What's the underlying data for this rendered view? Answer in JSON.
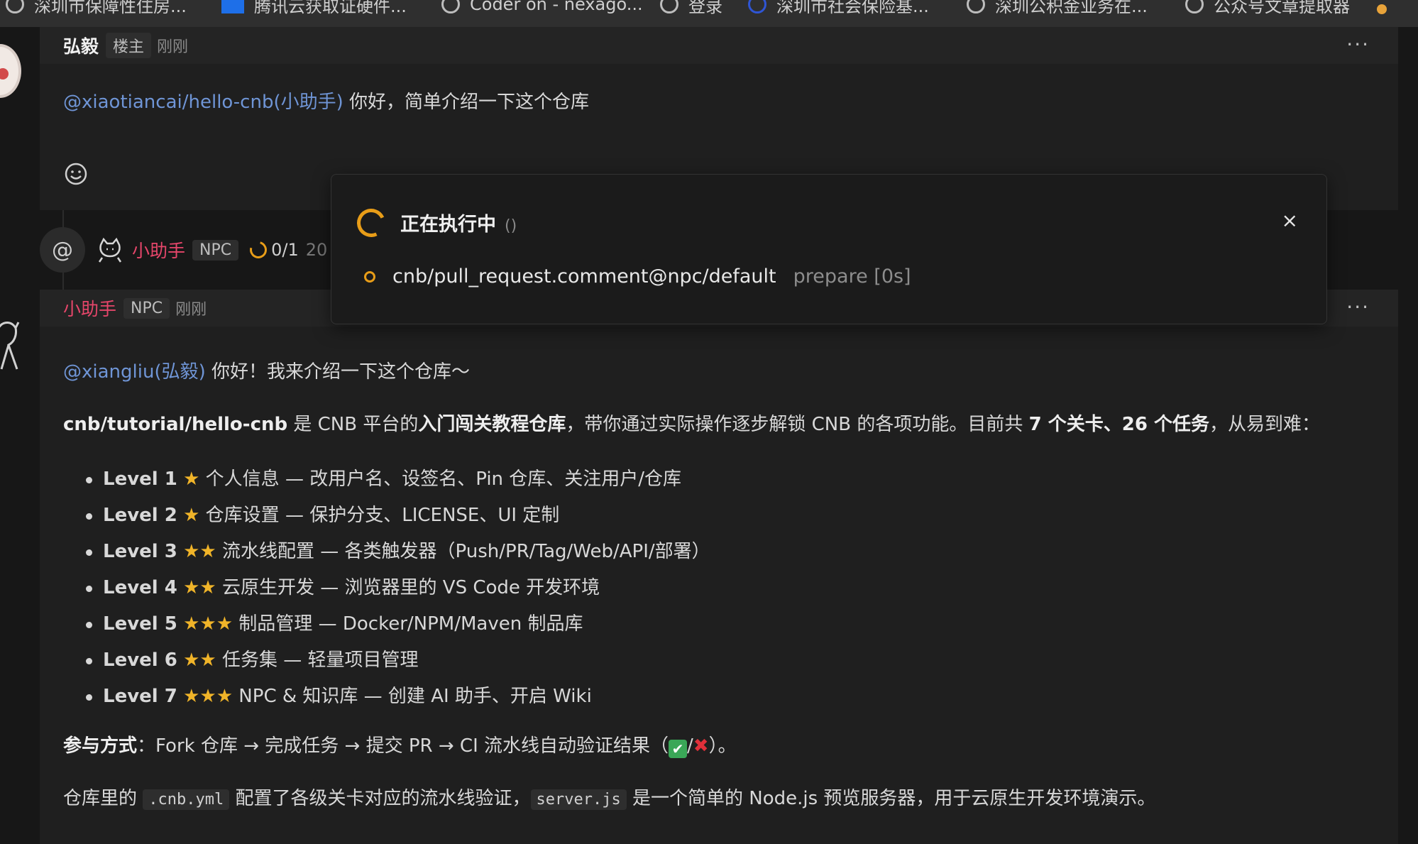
{
  "bookmarks": [
    {
      "label": "深圳市保障性住房..."
    },
    {
      "label": "腾讯云获取证硬件..."
    },
    {
      "label": "Coder on - nexago..."
    },
    {
      "label": "登录"
    },
    {
      "label": "深圳市社会保险基..."
    },
    {
      "label": "深圳公积金业务在..."
    },
    {
      "label": "公众号文章提取器"
    }
  ],
  "comment1": {
    "author": "弘毅",
    "tag": "楼主",
    "time": "刚刚",
    "more": "···",
    "mention": "@xiaotiancai/hello-cnb(小助手)",
    "text": " 你好，简单介绍一下这个仓库"
  },
  "event": {
    "at_symbol": "@",
    "actor": "小助手",
    "tag": "NPC",
    "progress": "0/1",
    "cut_text": "20"
  },
  "popup": {
    "title": "正在执行中",
    "paren": "()",
    "close": "×",
    "job_name": "cnb/pull_request.comment@npc/default",
    "job_status": "prepare [0s]"
  },
  "comment2": {
    "author": "小助手",
    "tag": "NPC",
    "time": "刚刚",
    "more": "···",
    "mention": "@xiangliu(弘毅)",
    "greeting": " 你好！我来介绍一下这个仓库～",
    "intro": {
      "repo": "cnb/tutorial/hello-cnb",
      "t1": " 是 CNB 平台的",
      "bold1": "入门闯关教程仓库",
      "t2": "，带你通过实际操作逐步解锁 CNB 的各项功能。目前共 ",
      "bold2": "7 个关卡、26 个任务",
      "t3": "，从易到难："
    },
    "levels": [
      {
        "level": "Level 1",
        "stars": "★",
        "desc": " 个人信息 — 改用户名、设签名、Pin 仓库、关注用户/仓库"
      },
      {
        "level": "Level 2",
        "stars": "★",
        "desc": " 仓库设置 — 保护分支、LICENSE、UI 定制"
      },
      {
        "level": "Level 3",
        "stars": "★★",
        "desc": " 流水线配置 — 各类触发器（Push/PR/Tag/Web/API/部署）"
      },
      {
        "level": "Level 4",
        "stars": "★★",
        "desc": " 云原生开发 — 浏览器里的 VS Code 开发环境"
      },
      {
        "level": "Level 5",
        "stars": "★★★",
        "desc": " 制品管理 — Docker/NPM/Maven 制品库"
      },
      {
        "level": "Level 6",
        "stars": "★★",
        "desc": " 任务集 — 轻量项目管理"
      },
      {
        "level": "Level 7",
        "stars": "★★★",
        "desc": " NPC & 知识库 — 创建 AI 助手、开启 Wiki"
      }
    ],
    "participation": {
      "label": "参与方式",
      "text": "：Fork 仓库 → 完成任务 → 提交 PR → CI 流水线自动验证结果（",
      "check": "✔",
      "slash": "/",
      "cross": "✖",
      "end": "）。"
    },
    "last_line": {
      "t1": "仓库里的 ",
      "code1": ".cnb.yml",
      "t2": " 配置了各级关卡对应的流水线验证，",
      "code2": "server.js",
      "t3": " 是一个简单的 Node.js 预览服务器，用于云原生开发环境演示。"
    }
  },
  "colors": {
    "accent_orange": "#e89d18",
    "mention_blue": "#6f95d6",
    "npc_pink": "#e6466a",
    "star_gold": "#f0b429"
  }
}
